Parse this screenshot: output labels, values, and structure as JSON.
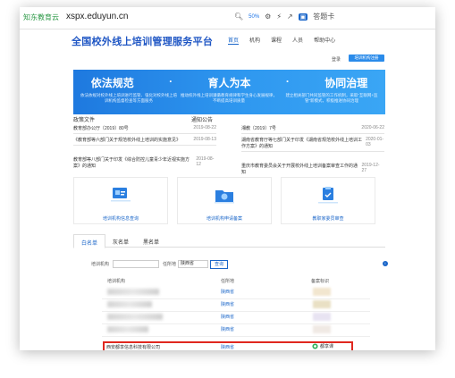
{
  "browser": {
    "extension": "知东教育云",
    "url": "xspx.eduyun.cn",
    "zoom": "50%",
    "extension2": "答题卡"
  },
  "site": {
    "title": "全国校外线上培训管理服务平台",
    "nav": [
      "首页",
      "机构",
      "课程",
      "人员",
      "帮助中心"
    ],
    "login": "登录",
    "register": "培训机构注册"
  },
  "banner": {
    "slogans": [
      "依法规范",
      "育人为本",
      "协同治理"
    ],
    "col1": "依法依规对校外线上培训进行监管、强化对校外线上培训机构监督检查等方面服务",
    "col2": "推动校外线上培训遵循教育规律和学生身心发展规律，不断提高培训质量",
    "col3": "建立相关部门共同监管的工作机制，采取“互联网+监管”新模式，积极推进协同治理"
  },
  "tags": {
    "policy": "政策文件",
    "notice": "通知公告"
  },
  "news": [
    {
      "title": "教育部办公厅〔2019〕80号",
      "date": "2019-08-22"
    },
    {
      "title": "《教育部等六部门关于规范校外线上培训的实施意见》",
      "date": "2019-08-13"
    },
    {
      "title": "教育部等八部门关于印发《综合防控儿童青少年近视实施方案》的通知",
      "date": "2019-08-12"
    },
    {
      "title": "湘教〔2019〕7号",
      "date": "2020-06-22"
    },
    {
      "title": "湖南省教育厅等七部门关于印发《湖南省规范校外线上培训工作方案》的通知",
      "date": "2020-01-03"
    },
    {
      "title": "重庆市教育委员会关于开展校外线上培训备案审查工作的通知",
      "date": "2019-12-27"
    }
  ],
  "cards": [
    "培训机构信息查询",
    "培训机构申请备案",
    "教职家委员审查"
  ],
  "list": {
    "tabs": [
      "白名单",
      "灰名单",
      "黑名单"
    ],
    "search_label": "培训机构",
    "location_label": "任所地",
    "location_value": "陕西省",
    "search_button": "查询",
    "col_name": "培训机构",
    "col_loc": "任所地",
    "col_cert": "备案标识",
    "row_location": "陕西省",
    "highlight_name": "西安都享信息科技有限公司",
    "highlight_loc": "陕西省",
    "highlight_cert": "都享课"
  }
}
